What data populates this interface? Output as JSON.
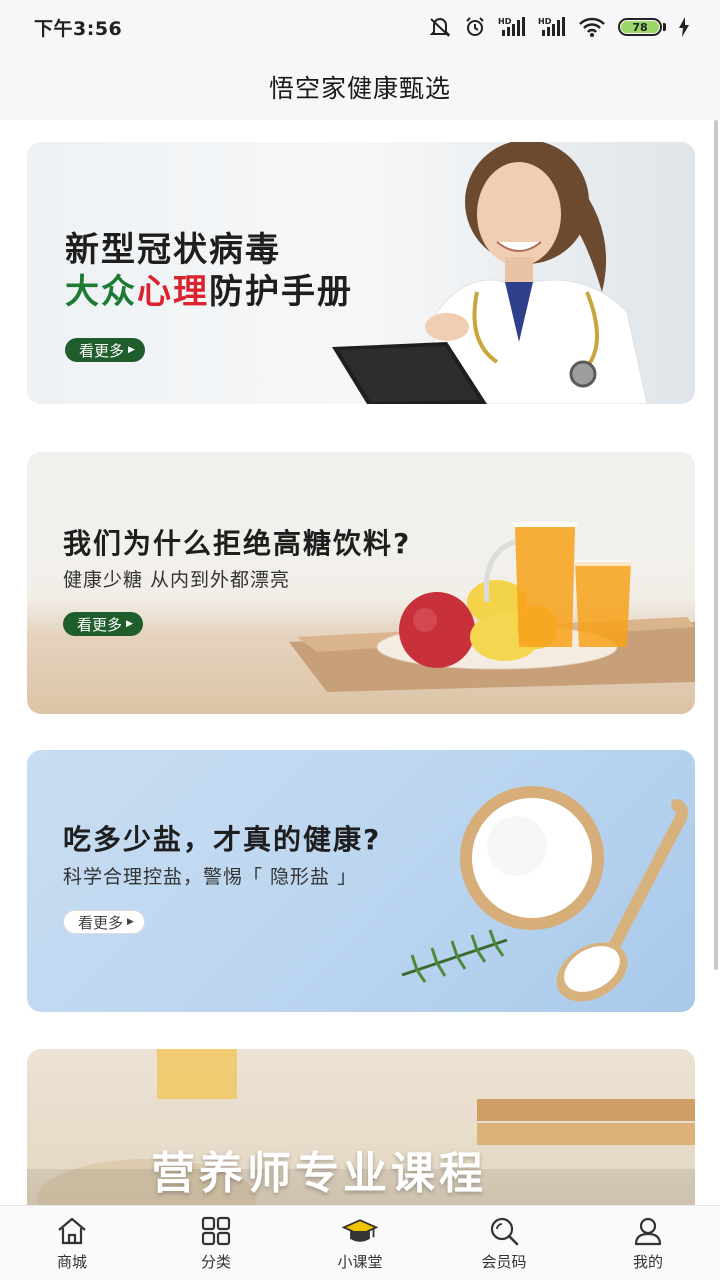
{
  "status_bar": {
    "time": "下午3:56",
    "battery": "78"
  },
  "header": {
    "title": "悟空家健康甄选"
  },
  "banners": [
    {
      "line1": "新型冠状病毒",
      "line2_a": "大众",
      "line2_b": "心理",
      "line2_c": "防护手册",
      "more": "看更多"
    },
    {
      "title": "我们为什么拒绝高糖饮料?",
      "subtitle": "健康少糖 从内到外都漂亮",
      "more": "看更多"
    },
    {
      "title": "吃多少盐，才真的健康?",
      "subtitle": "科学合理控盐，警惕「 隐形盐 」",
      "more": "看更多"
    },
    {
      "title": "营养师专业课程"
    }
  ],
  "tabs": [
    {
      "label": "商城",
      "icon": "home-icon"
    },
    {
      "label": "分类",
      "icon": "grid-icon"
    },
    {
      "label": "小课堂",
      "icon": "graduation-cap-icon"
    },
    {
      "label": "会员码",
      "icon": "search-icon"
    },
    {
      "label": "我的",
      "icon": "user-icon"
    }
  ],
  "colors": {
    "brand_green": "#1f5e2c",
    "accent_red": "#d9232e",
    "accent_green": "#1f7a33"
  }
}
